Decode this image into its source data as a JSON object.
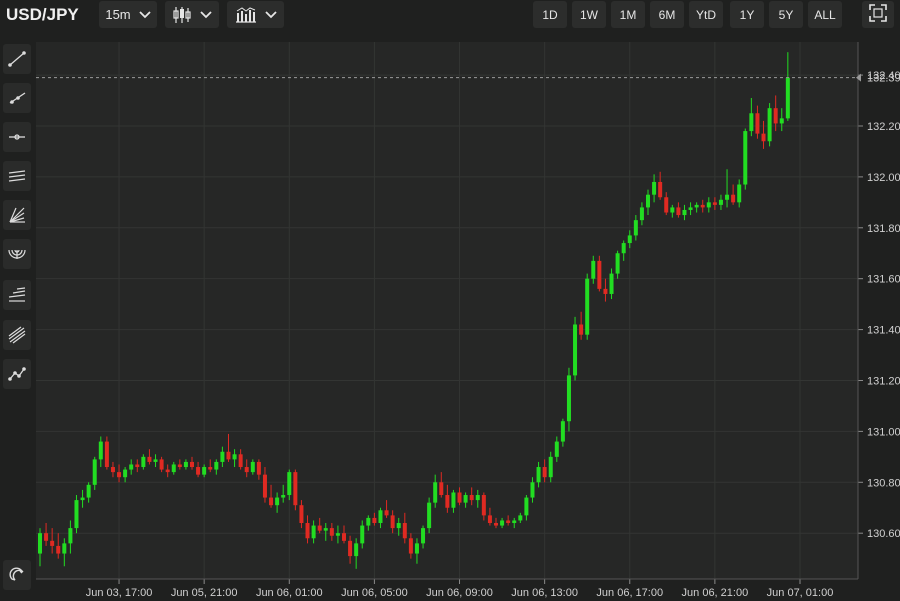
{
  "header": {
    "symbol": "USD/JPY",
    "interval": "15m",
    "ranges": [
      "1D",
      "1W",
      "1M",
      "6M",
      "YtD",
      "1Y",
      "5Y",
      "ALL"
    ]
  },
  "toolbar_icons": [
    "trend-line-icon",
    "ray-icon",
    "horizontal-line-icon",
    "parallel-channel-icon",
    "fan-icon",
    "arc-icon",
    "fib-retracement-icon",
    "pitchfork-icon",
    "path-icon"
  ],
  "chart_data": {
    "type": "candlestick",
    "title": "",
    "ylim": [
      130.42,
      132.53
    ],
    "y_ticks": [
      130.6,
      130.8,
      131.0,
      131.2,
      131.4,
      131.6,
      131.8,
      132.0,
      132.2,
      132.4
    ],
    "y_tick_labels": [
      "130.60",
      "130.80",
      "131.00",
      "131.20",
      "131.40",
      "131.60",
      "131.80",
      "132.00",
      "132.20",
      "132.40"
    ],
    "x_tick_labels": [
      "Jun 03, 17:00",
      "Jun 05, 21:00",
      "Jun 06, 01:00",
      "Jun 06, 05:00",
      "Jun 06, 09:00",
      "Jun 06, 13:00",
      "Jun 06, 17:00",
      "Jun 06, 21:00",
      "Jun 07, 01:00"
    ],
    "x_tick_index": [
      13,
      27,
      41,
      55,
      69,
      83,
      97,
      111,
      125
    ],
    "last_price": 132.39,
    "last_price_label": "132.39",
    "grid": true,
    "up_color": "#22dd22",
    "down_color": "#e02a22",
    "candles": [
      [
        130.52,
        130.62,
        130.47,
        130.6
      ],
      [
        130.6,
        130.64,
        130.55,
        130.57
      ],
      [
        130.57,
        130.62,
        130.52,
        130.55
      ],
      [
        130.55,
        130.6,
        130.5,
        130.52
      ],
      [
        130.52,
        130.58,
        130.47,
        130.56
      ],
      [
        130.56,
        130.65,
        130.52,
        130.62
      ],
      [
        130.62,
        130.75,
        130.6,
        130.73
      ],
      [
        130.73,
        130.77,
        130.7,
        130.74
      ],
      [
        130.74,
        130.8,
        130.72,
        130.79
      ],
      [
        130.79,
        130.9,
        130.77,
        130.89
      ],
      [
        130.89,
        130.98,
        130.86,
        130.96
      ],
      [
        130.96,
        130.98,
        130.85,
        130.86
      ],
      [
        130.86,
        130.88,
        130.82,
        130.84
      ],
      [
        130.84,
        130.87,
        130.8,
        130.82
      ],
      [
        130.82,
        130.86,
        130.8,
        130.85
      ],
      [
        130.85,
        130.89,
        130.83,
        130.87
      ],
      [
        130.87,
        130.89,
        130.84,
        130.86
      ],
      [
        130.86,
        130.91,
        130.85,
        130.9
      ],
      [
        130.9,
        130.93,
        130.87,
        130.88
      ],
      [
        130.88,
        130.91,
        130.86,
        130.89
      ],
      [
        130.89,
        130.9,
        130.84,
        130.85
      ],
      [
        130.85,
        130.87,
        130.82,
        130.84
      ],
      [
        130.84,
        130.88,
        130.83,
        130.87
      ],
      [
        130.87,
        130.89,
        130.85,
        130.86
      ],
      [
        130.86,
        130.89,
        130.85,
        130.88
      ],
      [
        130.88,
        130.9,
        130.85,
        130.86
      ],
      [
        130.86,
        130.88,
        130.82,
        130.83
      ],
      [
        130.83,
        130.87,
        130.82,
        130.86
      ],
      [
        130.86,
        130.89,
        130.84,
        130.85
      ],
      [
        130.85,
        130.89,
        130.83,
        130.88
      ],
      [
        130.88,
        130.94,
        130.86,
        130.92
      ],
      [
        130.92,
        130.99,
        130.88,
        130.89
      ],
      [
        130.89,
        130.93,
        130.86,
        130.91
      ],
      [
        130.91,
        130.93,
        130.85,
        130.86
      ],
      [
        130.86,
        130.89,
        130.82,
        130.84
      ],
      [
        130.84,
        130.89,
        130.83,
        130.88
      ],
      [
        130.88,
        130.89,
        130.81,
        130.83
      ],
      [
        130.83,
        130.86,
        130.72,
        130.74
      ],
      [
        130.74,
        130.79,
        130.7,
        130.71
      ],
      [
        130.71,
        130.76,
        130.68,
        130.74
      ],
      [
        130.74,
        130.79,
        130.72,
        130.75
      ],
      [
        130.75,
        130.85,
        130.73,
        130.84
      ],
      [
        130.84,
        130.85,
        130.69,
        130.71
      ],
      [
        130.71,
        130.73,
        130.62,
        130.64
      ],
      [
        130.64,
        130.67,
        130.56,
        130.58
      ],
      [
        130.58,
        130.65,
        130.56,
        130.63
      ],
      [
        130.63,
        130.66,
        130.6,
        130.61
      ],
      [
        130.61,
        130.64,
        130.57,
        130.62
      ],
      [
        130.62,
        130.64,
        130.57,
        130.59
      ],
      [
        130.59,
        130.63,
        130.56,
        130.6
      ],
      [
        130.6,
        130.63,
        130.56,
        130.57
      ],
      [
        130.57,
        130.59,
        130.48,
        130.51
      ],
      [
        130.51,
        130.58,
        130.46,
        130.56
      ],
      [
        130.56,
        130.65,
        130.54,
        130.63
      ],
      [
        130.63,
        130.67,
        130.61,
        130.66
      ],
      [
        130.66,
        130.68,
        130.63,
        130.64
      ],
      [
        130.64,
        130.7,
        130.62,
        130.69
      ],
      [
        130.69,
        130.73,
        130.66,
        130.67
      ],
      [
        130.67,
        130.69,
        130.6,
        130.62
      ],
      [
        130.62,
        130.66,
        130.59,
        130.64
      ],
      [
        130.64,
        130.68,
        130.56,
        130.58
      ],
      [
        130.58,
        130.6,
        130.5,
        130.52
      ],
      [
        130.52,
        130.58,
        130.48,
        130.56
      ],
      [
        130.56,
        130.63,
        130.54,
        130.62
      ],
      [
        130.62,
        130.74,
        130.6,
        130.72
      ],
      [
        130.72,
        130.83,
        130.7,
        130.8
      ],
      [
        130.8,
        130.84,
        130.74,
        130.75
      ],
      [
        130.75,
        130.79,
        130.68,
        130.7
      ],
      [
        130.7,
        130.77,
        130.68,
        130.76
      ],
      [
        130.76,
        130.78,
        130.71,
        130.72
      ],
      [
        130.72,
        130.76,
        130.7,
        130.75
      ],
      [
        130.75,
        130.78,
        130.71,
        130.73
      ],
      [
        130.73,
        130.77,
        130.7,
        130.75
      ],
      [
        130.75,
        130.76,
        130.65,
        130.67
      ],
      [
        130.67,
        130.7,
        130.63,
        130.64
      ],
      [
        130.64,
        130.66,
        130.62,
        130.63
      ],
      [
        130.63,
        130.66,
        130.62,
        130.65
      ],
      [
        130.65,
        130.67,
        130.63,
        130.64
      ],
      [
        130.64,
        130.66,
        130.62,
        130.65
      ],
      [
        130.65,
        130.68,
        130.64,
        130.67
      ],
      [
        130.67,
        130.75,
        130.65,
        130.74
      ],
      [
        130.74,
        130.82,
        130.72,
        130.8
      ],
      [
        130.8,
        130.88,
        130.78,
        130.86
      ],
      [
        130.86,
        130.89,
        130.8,
        130.82
      ],
      [
        130.82,
        130.92,
        130.8,
        130.9
      ],
      [
        130.9,
        130.98,
        130.88,
        130.96
      ],
      [
        130.96,
        131.05,
        130.94,
        131.04
      ],
      [
        131.04,
        131.25,
        131.0,
        131.22
      ],
      [
        131.22,
        131.45,
        131.2,
        131.42
      ],
      [
        131.42,
        131.47,
        131.36,
        131.38
      ],
      [
        131.38,
        131.62,
        131.36,
        131.6
      ],
      [
        131.6,
        131.69,
        131.58,
        131.67
      ],
      [
        131.67,
        131.69,
        131.55,
        131.56
      ],
      [
        131.56,
        131.6,
        131.51,
        131.54
      ],
      [
        131.54,
        131.64,
        131.52,
        131.62
      ],
      [
        131.62,
        131.71,
        131.6,
        131.7
      ],
      [
        131.7,
        131.75,
        131.67,
        131.74
      ],
      [
        131.74,
        131.79,
        131.72,
        131.77
      ],
      [
        131.77,
        131.85,
        131.75,
        131.83
      ],
      [
        131.83,
        131.9,
        131.81,
        131.88
      ],
      [
        131.88,
        131.95,
        131.85,
        131.93
      ],
      [
        131.93,
        132.01,
        131.9,
        131.98
      ],
      [
        131.98,
        132.02,
        131.91,
        131.92
      ],
      [
        131.92,
        131.94,
        131.85,
        131.86
      ],
      [
        131.86,
        131.89,
        131.84,
        131.88
      ],
      [
        131.88,
        131.9,
        131.84,
        131.85
      ],
      [
        131.85,
        131.89,
        131.83,
        131.87
      ],
      [
        131.87,
        131.9,
        131.85,
        131.88
      ],
      [
        131.88,
        131.9,
        131.86,
        131.89
      ],
      [
        131.89,
        131.91,
        131.86,
        131.88
      ],
      [
        131.88,
        131.92,
        131.86,
        131.9
      ],
      [
        131.9,
        131.92,
        131.87,
        131.89
      ],
      [
        131.89,
        131.93,
        131.87,
        131.91
      ],
      [
        131.91,
        132.03,
        131.88,
        131.93
      ],
      [
        131.93,
        131.97,
        131.89,
        131.9
      ],
      [
        131.9,
        131.99,
        131.88,
        131.97
      ],
      [
        131.97,
        132.19,
        131.95,
        132.18
      ],
      [
        132.18,
        132.31,
        132.16,
        132.25
      ],
      [
        132.25,
        132.28,
        132.15,
        132.17
      ],
      [
        132.17,
        132.22,
        132.11,
        132.14
      ],
      [
        132.14,
        132.29,
        132.12,
        132.27
      ],
      [
        132.27,
        132.32,
        132.18,
        132.21
      ],
      [
        132.21,
        132.27,
        132.18,
        132.23
      ],
      [
        132.23,
        132.49,
        132.22,
        132.39
      ]
    ]
  }
}
